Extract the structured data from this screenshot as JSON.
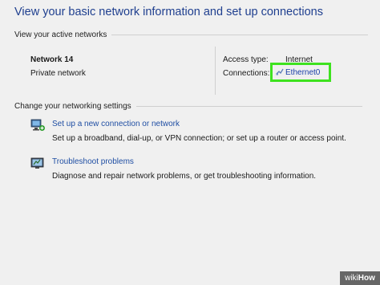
{
  "header": {
    "title": "View your basic network information and set up connections"
  },
  "active_networks": {
    "heading": "View your active networks",
    "network_name": "Network 14",
    "network_category": "Private network",
    "access_type_label": "Access type:",
    "access_type_value": "Internet",
    "connections_label": "Connections:",
    "connections_value": "Ethernet0"
  },
  "change_settings": {
    "heading": "Change your networking settings",
    "tasks": [
      {
        "link": "Set up a new connection or network",
        "description": "Set up a broadband, dial-up, or VPN connection; or set up a router or access point.",
        "icon": "new-connection-icon"
      },
      {
        "link": "Troubleshoot problems",
        "description": "Diagnose and repair network problems, or get troubleshooting information.",
        "icon": "troubleshoot-icon"
      }
    ]
  },
  "watermark": {
    "prefix": "wiki",
    "suffix": "How"
  },
  "colors": {
    "highlight": "#3ee21f",
    "link": "#1f4ea3",
    "title": "#1f3f8f"
  }
}
